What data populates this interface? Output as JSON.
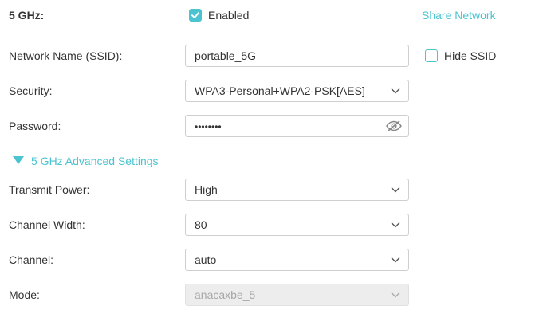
{
  "band": {
    "label": "5 GHz:",
    "enabled_label": "Enabled",
    "enabled_checked": true,
    "share_label": "Share Network"
  },
  "ssid": {
    "label": "Network Name (SSID):",
    "value": "portable_5G",
    "hide_label": "Hide SSID",
    "hide_checked": false
  },
  "security": {
    "label": "Security:",
    "value": "WPA3-Personal+WPA2-PSK[AES]"
  },
  "password": {
    "label": "Password:",
    "value": "••••••••",
    "toggle_icon": "eye-off-icon"
  },
  "advanced": {
    "label": "5 GHz Advanced Settings",
    "expanded": true
  },
  "transmit_power": {
    "label": "Transmit Power:",
    "value": "High"
  },
  "channel_width": {
    "label": "Channel Width:",
    "value": "80"
  },
  "channel": {
    "label": "Channel:",
    "value": "auto"
  },
  "mode": {
    "label": "Mode:",
    "value": "anacaxbe_5",
    "disabled": true
  },
  "colors": {
    "accent": "#4bc3d0",
    "text": "#333333",
    "border": "#cfcfcf"
  }
}
